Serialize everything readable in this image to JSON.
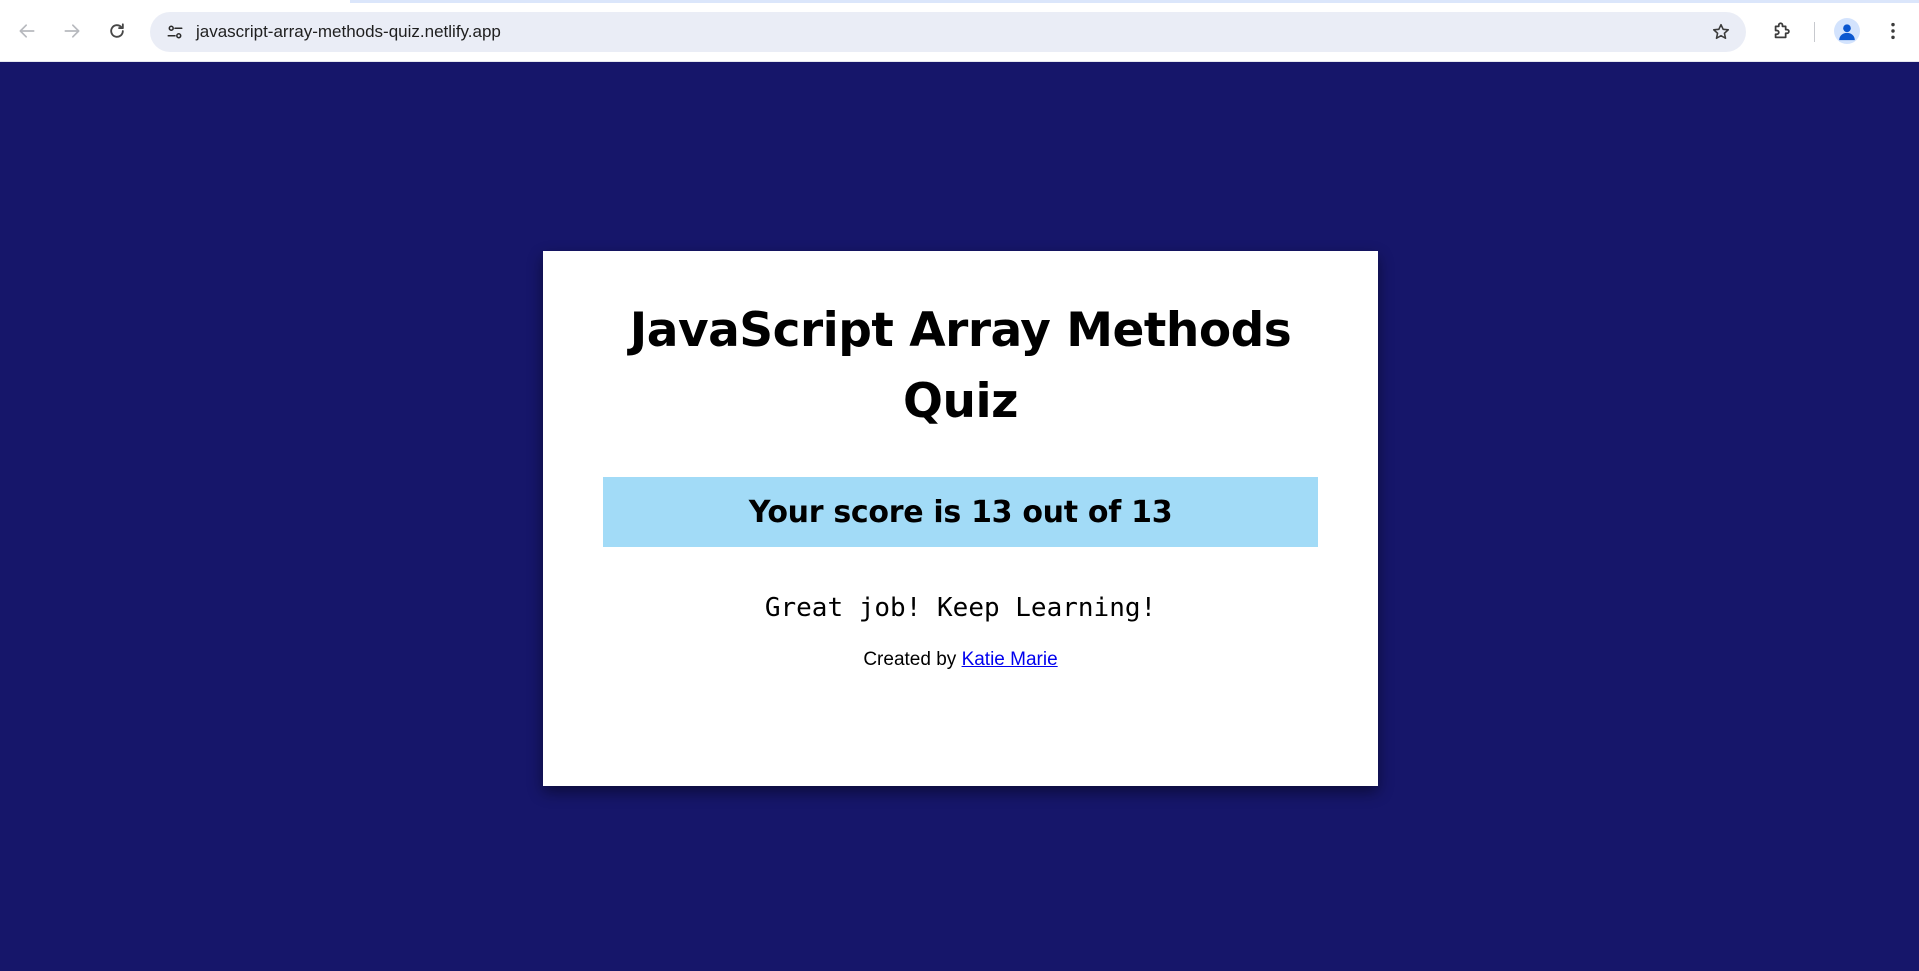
{
  "browser": {
    "url": "javascript-array-methods-quiz.netlify.app",
    "icons": {
      "back": "arrow-left-icon",
      "forward": "arrow-right-icon",
      "reload": "reload-icon",
      "site_info": "tune-icon",
      "bookmark": "star-icon",
      "extensions": "puzzle-icon",
      "profile": "avatar-icon",
      "menu": "kebab-menu-icon"
    }
  },
  "quiz": {
    "title": "JavaScript Array Methods Quiz",
    "score_text": "Your score is 13 out of 13",
    "score": 13,
    "total": 13,
    "message": "Great job! Keep Learning!",
    "credit_prefix": "Created by",
    "author_link": "Katie Marie"
  },
  "colors": {
    "page_background": "#16166a",
    "card_background": "#ffffff",
    "score_banner": "#a2dbf7",
    "link": "#0000ee"
  }
}
